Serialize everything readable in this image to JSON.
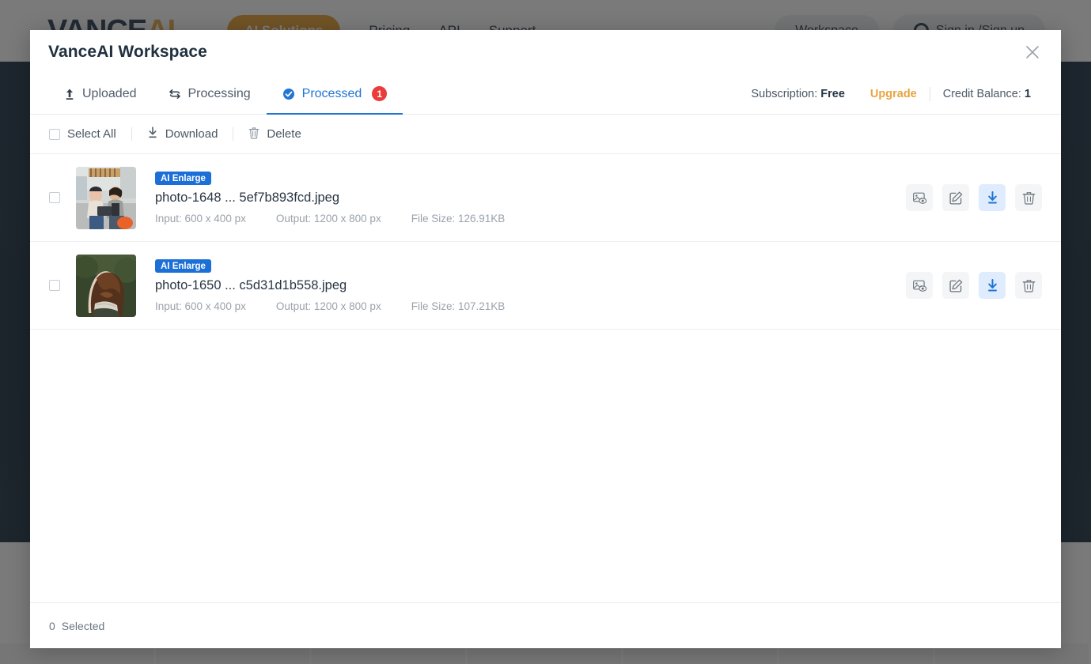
{
  "background": {
    "logo_text": "VANCE",
    "logo_accent": "AI",
    "nav": [
      {
        "label": "AI Solutions",
        "style": "pill"
      },
      {
        "label": "Pricing",
        "style": "plain"
      },
      {
        "label": "API",
        "style": "plain"
      },
      {
        "label": "Support",
        "style": "plain"
      }
    ],
    "workspace_button": "Workspace",
    "signin_button": "Sign in /Sign up"
  },
  "modal": {
    "title": "VanceAI Workspace",
    "close_icon": "close-icon",
    "tabs": [
      {
        "id": "uploaded",
        "label": "Uploaded",
        "icon": "upload-icon",
        "active": false,
        "badge": null
      },
      {
        "id": "processing",
        "label": "Processing",
        "icon": "refresh-icon",
        "active": false,
        "badge": null
      },
      {
        "id": "processed",
        "label": "Processed",
        "icon": "check-circle-icon",
        "active": true,
        "badge": "1"
      }
    ],
    "account": {
      "subscription_label": "Subscription:",
      "subscription_value": "Free",
      "upgrade_label": "Upgrade",
      "credit_label": "Credit Balance:",
      "credit_value": "1"
    },
    "toolbar": {
      "select_all_label": "Select All",
      "download_label": "Download",
      "delete_label": "Delete",
      "select_all_checked": false
    },
    "files": [
      {
        "tag": "AI Enlarge",
        "name": "photo-1648 ... 5ef7b893fcd.jpeg",
        "input_label": "Input: 600 x 400 px",
        "output_label": "Output: 1200 x 800 px",
        "filesize_label": "File Size: 126.91KB",
        "checked": false,
        "thumb": "two-people-on-bench"
      },
      {
        "tag": "AI Enlarge",
        "name": "photo-1650 ... c5d31d1b558.jpeg",
        "input_label": "Input: 600 x 400 px",
        "output_label": "Output: 1200 x 800 px",
        "filesize_label": "File Size: 107.21KB",
        "checked": false,
        "thumb": "woman-long-hair-back"
      }
    ],
    "row_actions": [
      {
        "id": "compare",
        "icon": "image-preview-icon",
        "primary": false
      },
      {
        "id": "edit",
        "icon": "edit-square-icon",
        "primary": false
      },
      {
        "id": "download",
        "icon": "download-icon",
        "primary": true
      },
      {
        "id": "delete",
        "icon": "trash-icon",
        "primary": false
      }
    ],
    "footer": {
      "selected_count": "0",
      "selected_label": "Selected"
    }
  },
  "colors": {
    "accent_blue": "#2275d4",
    "tag_blue": "#1b6fd6",
    "badge_red": "#ec3b3b",
    "upgrade_gold": "#e8a33d",
    "download_bg": "#dfecfd",
    "page_navy": "#0a2033"
  }
}
